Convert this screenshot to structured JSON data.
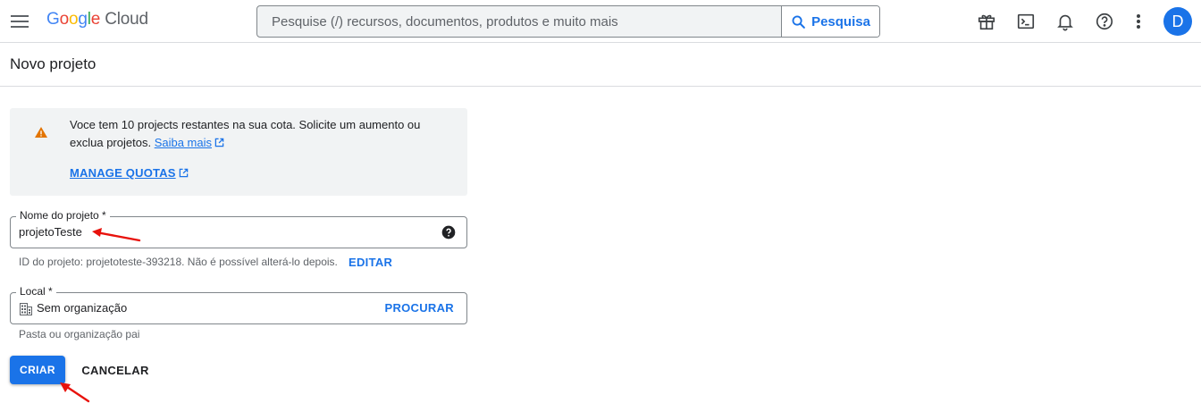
{
  "brand": {
    "google_letters": [
      "G",
      "o",
      "o",
      "g",
      "l",
      "e"
    ],
    "product": "Cloud"
  },
  "search": {
    "placeholder": "Pesquise (/) recursos, documentos, produtos e muito mais",
    "button_label": "Pesquisa"
  },
  "header_icons": [
    "gift-icon",
    "terminal-icon",
    "bell-icon",
    "help-circle-icon",
    "more-vert-icon"
  ],
  "user": {
    "avatar_initial": "D"
  },
  "page": {
    "title": "Novo projeto"
  },
  "notice": {
    "text_line": "Voce tem 10 projects restantes na sua cota. Solicite um aumento ou exclua projetos.",
    "learn_more": "Saiba mais",
    "manage_quotas": "MANAGE QUOTAS"
  },
  "project_name": {
    "label": "Nome do projeto *",
    "value": "projetoTeste",
    "hint": "ID do projeto: projetoteste-393218. Não é possível alterá-lo depois.",
    "edit_label": "EDITAR"
  },
  "location": {
    "label": "Local *",
    "value": "Sem organização",
    "browse_label": "PROCURAR",
    "hint": "Pasta ou organização pai"
  },
  "actions": {
    "create_label": "CRIAR",
    "cancel_label": "CANCELAR"
  },
  "colors": {
    "accent": "#1a73e8",
    "warning": "#e37400",
    "annotation_arrow": "#e8120c"
  }
}
